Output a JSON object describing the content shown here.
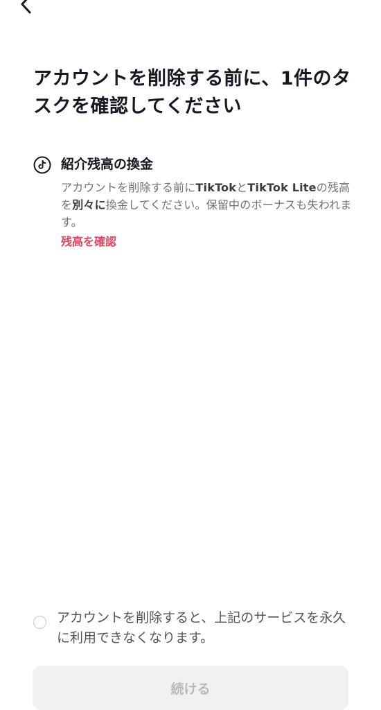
{
  "header": {
    "back_icon": "chevron-left-icon"
  },
  "page": {
    "title": "アカウントを削除する前に、1件のタスクを確認してください"
  },
  "task": {
    "icon": "tiktok-logo-icon",
    "title": "紹介残高の換金",
    "description_parts": {
      "p1": "アカウントを削除する前に",
      "b1": "TikTok",
      "p2": "と",
      "b2": "TikTok Lite",
      "p3": "の残高を",
      "b3": "別々に",
      "p4": "換金してください。保留中のボーナスも失われます。"
    },
    "link_label": "残高を確認",
    "link_color": "#e0435e"
  },
  "consent": {
    "text": "アカウントを削除すると、上記のサービスを永久に利用できなくなります。",
    "checked": false
  },
  "footer": {
    "continue_label": "続ける",
    "disabled": true
  }
}
